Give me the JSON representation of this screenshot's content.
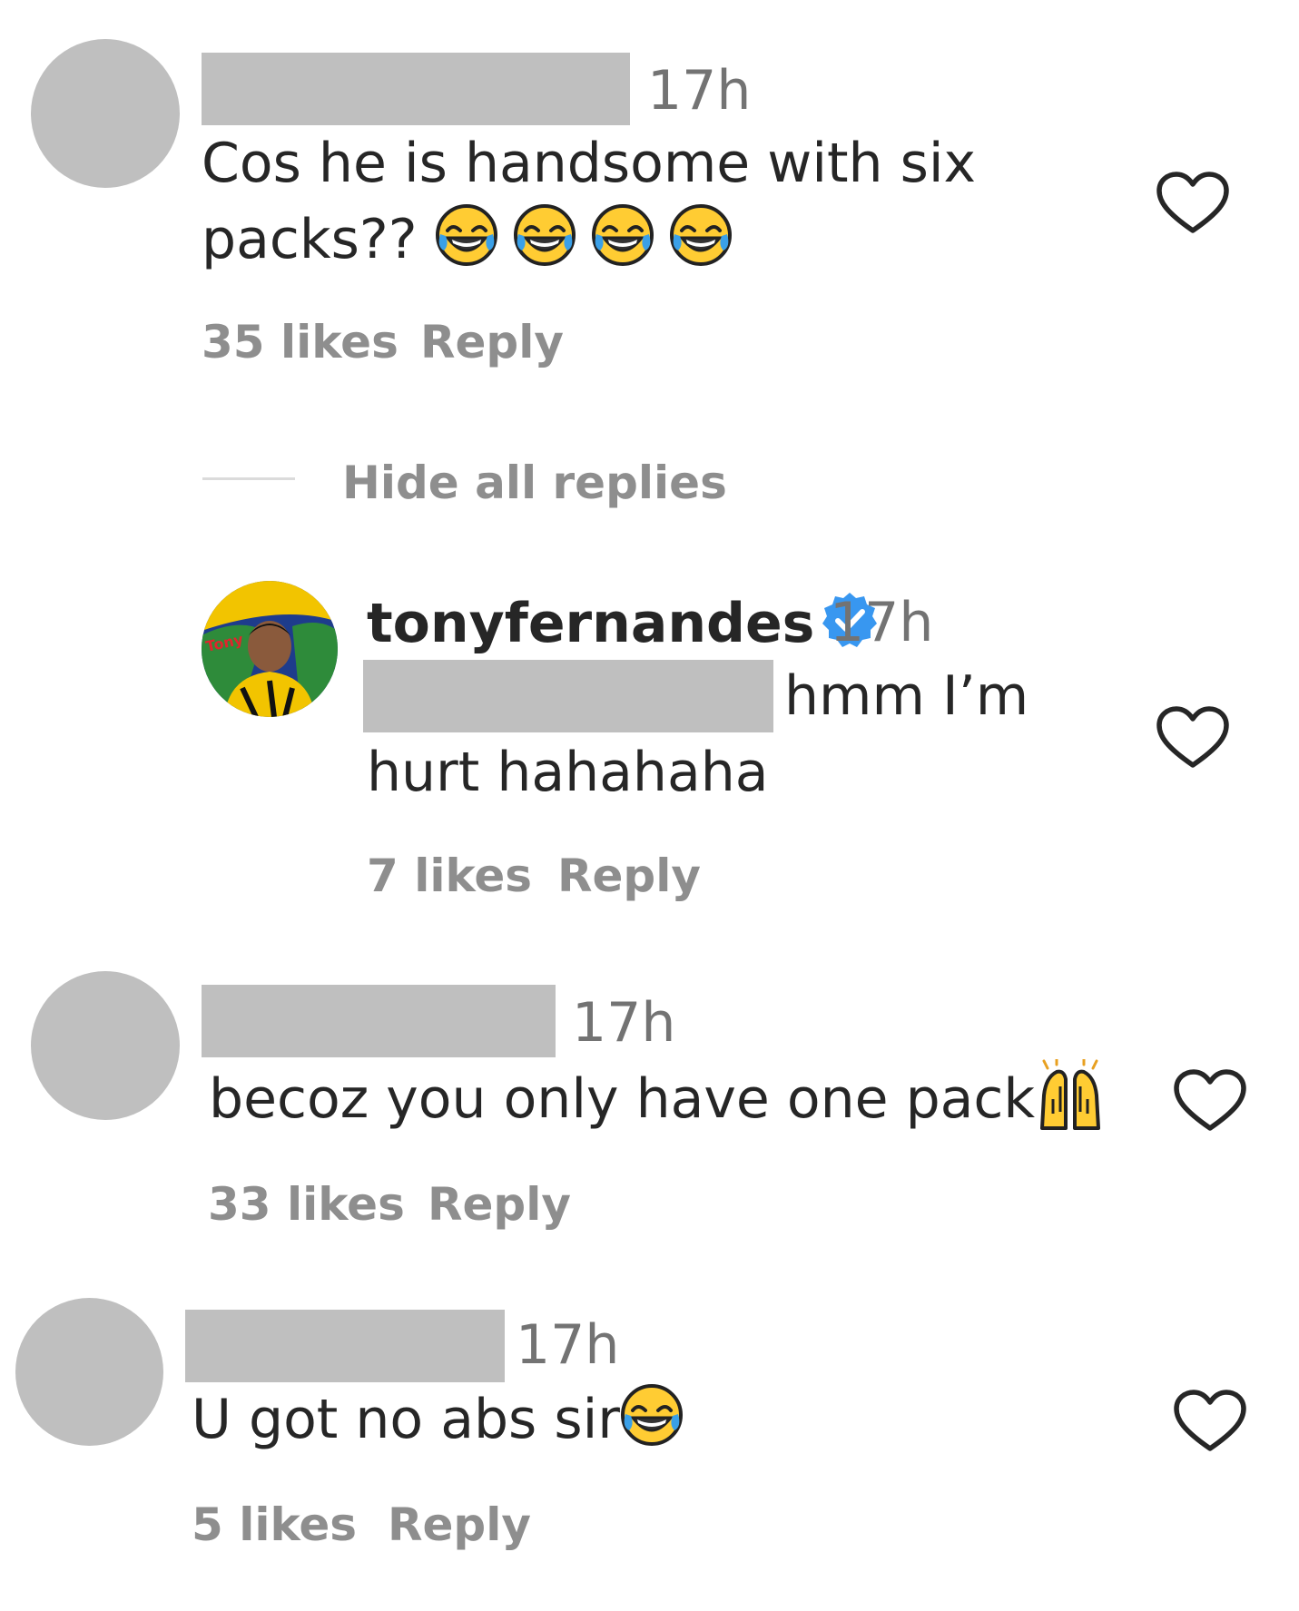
{
  "comments": [
    {
      "time": "17h",
      "line1": "Cos he is handsome with six",
      "line2": "packs?? ",
      "likes": "35 likes",
      "reply": "Reply"
    },
    {
      "time": "17h",
      "text": "becoz you only have one pack",
      "likes": "33 likes",
      "reply": "Reply"
    },
    {
      "time": "17h",
      "text": "U got no abs sir",
      "likes": "5 likes",
      "reply": "Reply"
    }
  ],
  "hide_replies": "Hide all replies",
  "reply_comment": {
    "username": "tonyfernandes",
    "time": "17h",
    "line1": "hmm I’m",
    "line2": "hurt hahahaha",
    "likes": "7 likes",
    "reply": "Reply"
  },
  "colors": {
    "text": "#262626",
    "muted": "#8e8e8e",
    "placeholder": "#bfbfbf",
    "verified": "#3897f0"
  },
  "icons": {
    "like": "heart-outline-icon",
    "verified": "verified-badge-icon",
    "emoji_laugh": "face-with-tears-of-joy",
    "emoji_hands": "raising-hands"
  }
}
